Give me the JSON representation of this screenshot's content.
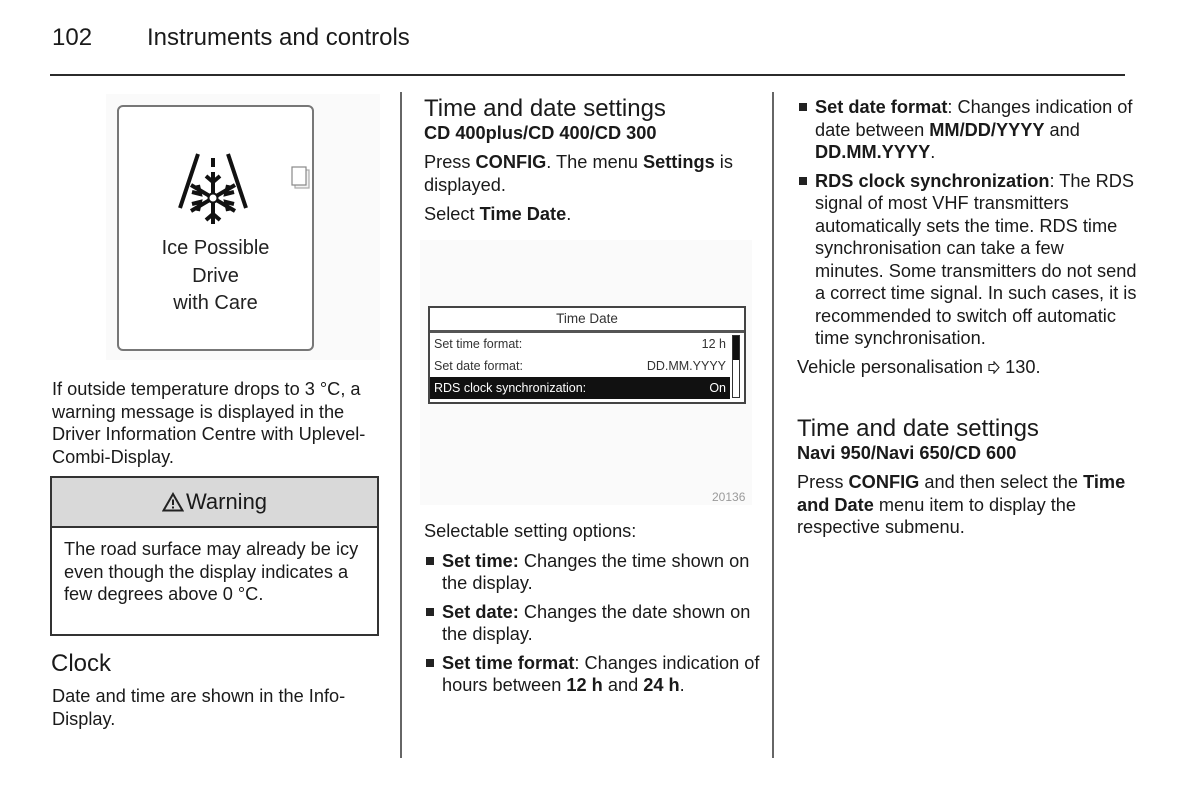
{
  "header": {
    "page_number": "102",
    "title": "Instruments and controls"
  },
  "left": {
    "figure": {
      "icon": "ice-warning-snowflake-icon",
      "message_lines": [
        "Ice Possible",
        "Drive",
        "with Care"
      ],
      "side_icon": "page-icon"
    },
    "intro": "If outside temperature drops to 3 °C, a warning message is displayed in the Driver Information Centre with Uplevel-Combi-Display.",
    "warning": {
      "icon": "warning-triangle-icon",
      "title": "Warning",
      "text": "The road surface may already be icy even though the display indicates a few degrees above 0 °C."
    },
    "clock": {
      "heading": "Clock",
      "text": "Date and time are shown in the Info-Display."
    }
  },
  "middle": {
    "heading": "Time and date settings",
    "subheading": "CD 400plus/CD 400/CD 300",
    "p1_pre": "Press ",
    "p1_b1": "CONFIG",
    "p1_mid": ". The menu ",
    "p1_b2": "Settings",
    "p1_post": " is displayed.",
    "p2_pre": "Select ",
    "p2_b": "Time Date",
    "p2_post": ".",
    "screen": {
      "title": "Time Date",
      "rows": [
        {
          "label": "Set time format:",
          "value": "12 h",
          "selected": false
        },
        {
          "label": "Set date format:",
          "value": "DD.MM.YYYY",
          "selected": false
        },
        {
          "label": "RDS clock synchronization:",
          "value": "On",
          "selected": true
        }
      ],
      "figure_id": "20136"
    },
    "options_intro": "Selectable setting options:",
    "options": [
      {
        "term": "Set time:",
        "desc": " Changes the time shown on the display."
      },
      {
        "term": "Set date:",
        "desc": " Changes the date shown on the display."
      },
      {
        "term": "Set time format",
        "desc_pre": ": Changes indication of hours between ",
        "b1": "12 h",
        "mid": " and ",
        "b2": "24 h",
        "post": "."
      }
    ]
  },
  "right": {
    "options": [
      {
        "term": "Set date format",
        "desc_pre": ": Changes indication of date between ",
        "b1": "MM/DD/YYYY",
        "mid": " and ",
        "b2": "DD.MM.YYYY",
        "post": "."
      },
      {
        "term": "RDS clock synchronization",
        "desc": ": The RDS signal of most VHF transmitters automatically sets the time. RDS time synchronisation can take a few minutes. Some transmitters do not send a correct time signal. In such cases, it is recommended to switch off automatic time synchronisation."
      }
    ],
    "xref_text": "Vehicle personalisation ",
    "xref_icon": "arrow-reference-icon",
    "xref_page": " 130.",
    "section2": {
      "heading": "Time and date settings",
      "subheading": "Navi 950/Navi 650/CD 600",
      "p_pre": "Press ",
      "p_b1": "CONFIG",
      "p_mid": " and then select the ",
      "p_b2": "Time and Date",
      "p_post": " menu item to display the respective submenu."
    }
  }
}
